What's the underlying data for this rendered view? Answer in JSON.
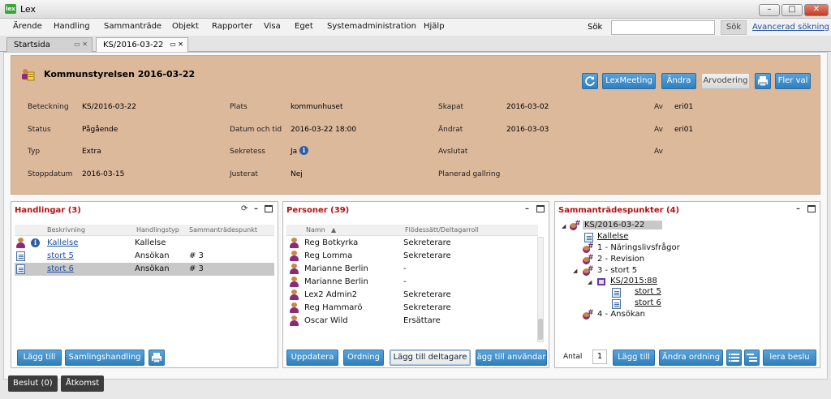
{
  "window": {
    "app_icon_text": "lex",
    "title": "Lex"
  },
  "menu": [
    "Ärende",
    "Handling",
    "Sammanträde",
    "Objekt",
    "Rapporter",
    "Visa",
    "Eget",
    "Systemadministration",
    "Hjälp"
  ],
  "search": {
    "label": "Sök",
    "value": "",
    "button": "Sök",
    "advanced": "Avancerad sökning"
  },
  "tabs": [
    {
      "label": "Startsida"
    },
    {
      "label": "KS/2016-03-22"
    }
  ],
  "meeting": {
    "title": "Kommunstyrelsen 2016-03-22",
    "buttons": {
      "lexmeeting": "LexMeeting",
      "andra": "Ändra",
      "arvodering": "Arvodering",
      "flerval": "Fler val"
    },
    "fields": {
      "beteckning_l": "Beteckning",
      "beteckning_v": "KS/2016-03-22",
      "status_l": "Status",
      "status_v": "Pågående",
      "typ_l": "Typ",
      "typ_v": "Extra",
      "stoppdatum_l": "Stoppdatum",
      "stoppdatum_v": "2016-03-15",
      "plats_l": "Plats",
      "plats_v": "kommunhuset",
      "datum_l": "Datum och tid",
      "datum_v": "2016-03-22 18:00",
      "sekretess_l": "Sekretess",
      "sekretess_v": "Ja",
      "justerat_l": "Justerat",
      "justerat_v": "Nej",
      "skapat_l": "Skapat",
      "skapat_v": "2016-03-02",
      "andrat_l": "Ändrat",
      "andrat_v": "2016-03-03",
      "avslutat_l": "Avslutat",
      "gallring_l": "Planerad gallring",
      "av1_l": "Av",
      "av1_v": "eri01",
      "av2_l": "Av",
      "av2_v": "eri01",
      "av3_l": "Av"
    }
  },
  "handlingar": {
    "title": "Handlingar (3)",
    "columns": [
      "Beskrivning",
      "Handlingstyp",
      "Sammanträdespunkt"
    ],
    "rows": [
      {
        "desc": "Kallelse",
        "type": "Kallelse",
        "point": ""
      },
      {
        "desc": "stort 5",
        "type": "Ansökan",
        "point": "# 3"
      },
      {
        "desc": "stort 6",
        "type": "Ansökan",
        "point": "# 3"
      }
    ],
    "buttons": {
      "add": "Lägg till",
      "collection": "Samlingshandling"
    }
  },
  "personer": {
    "title": "Personer (39)",
    "columns": [
      "Namn",
      "Flödessätt/Deltagarroll"
    ],
    "rows": [
      {
        "name": "Reg Botkyrka",
        "role": "Sekreterare"
      },
      {
        "name": "Reg Lomma",
        "role": "Sekreterare"
      },
      {
        "name": "Marianne Berlin",
        "role": "-"
      },
      {
        "name": "Marianne Berlin",
        "role": "-"
      },
      {
        "name": "Lex2 Admin2",
        "role": "Sekreterare"
      },
      {
        "name": "Reg Hammarö",
        "role": "Sekreterare"
      },
      {
        "name": "Oscar Wild",
        "role": "Ersättare"
      }
    ],
    "buttons": {
      "update": "Uppdatera",
      "order": "Ordning",
      "add_participant": "Lägg till deltagare",
      "add_user": "ägg till användar"
    }
  },
  "punkter": {
    "title": "Sammanträdespunkter (4)",
    "tree": {
      "root": "KS/2016-03-22",
      "kallelse": "Kallelse",
      "p1": "1 - Näringslivsfrågor",
      "p2": "2 - Revision",
      "p3": "3 - stort 5",
      "case": "KS/2015:88",
      "doc5": "stort 5",
      "doc6": "stort 6",
      "p4": "4 - Ansökan"
    },
    "antal_label": "Antal",
    "antal_value": "1",
    "buttons": {
      "add": "Lägg till",
      "order": "Ändra ordning",
      "distribute": "lera beslu"
    }
  },
  "bottom": {
    "beslut": "Beslut (0)",
    "atkomst": "Åtkomst"
  },
  "colors": {
    "accent": "#2f7fbf",
    "meeting_bg": "#dcb99b",
    "panel_title": "#b81010"
  }
}
